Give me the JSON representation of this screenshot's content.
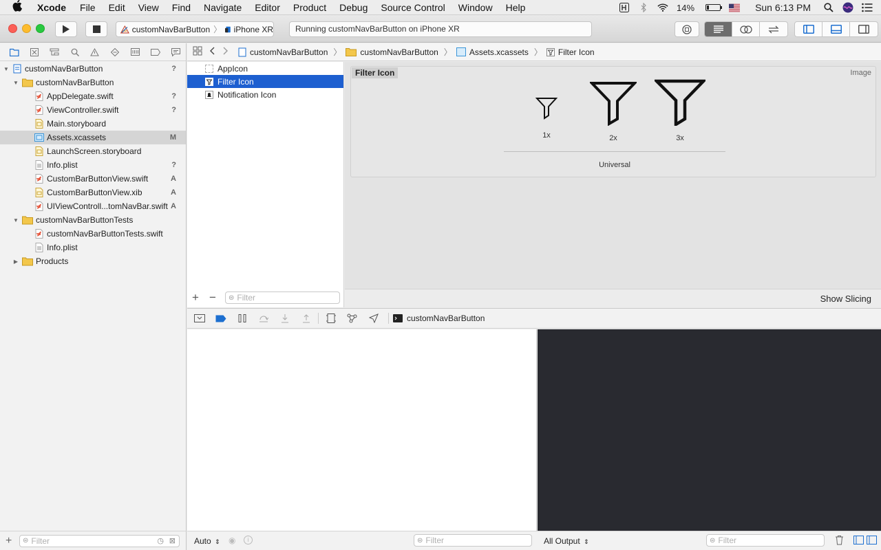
{
  "menubar": {
    "app_name": "Xcode",
    "items": [
      "File",
      "Edit",
      "View",
      "Find",
      "Navigate",
      "Editor",
      "Product",
      "Debug",
      "Source Control",
      "Window",
      "Help"
    ],
    "battery": "14%",
    "battery_level": 0.14,
    "clock": "Sun 6:13 PM"
  },
  "toolbar": {
    "scheme_name": "customNavBarButton",
    "device": "iPhone XR",
    "activity": "Running customNavBarButton on iPhone XR"
  },
  "navigator": {
    "tree": [
      {
        "label": "customNavBarButton",
        "status": "?"
      },
      {
        "label": "customNavBarButton",
        "status": ""
      },
      {
        "label": "AppDelegate.swift",
        "status": "?"
      },
      {
        "label": "ViewController.swift",
        "status": "?"
      },
      {
        "label": "Main.storyboard",
        "status": ""
      },
      {
        "label": "Assets.xcassets",
        "status": "M"
      },
      {
        "label": "LaunchScreen.storyboard",
        "status": ""
      },
      {
        "label": "Info.plist",
        "status": "?"
      },
      {
        "label": "CustomBarButtonView.swift",
        "status": "A"
      },
      {
        "label": "CustomBarButtonView.xib",
        "status": "A"
      },
      {
        "label": "UIViewControll...tomNavBar.swift",
        "status": "A"
      },
      {
        "label": "customNavBarButtonTests",
        "status": ""
      },
      {
        "label": "customNavBarButtonTests.swift",
        "status": ""
      },
      {
        "label": "Info.plist",
        "status": ""
      },
      {
        "label": "Products",
        "status": ""
      }
    ],
    "filter_placeholder": "Filter"
  },
  "jumpbar": {
    "crumbs": [
      "customNavBarButton",
      "customNavBarButton",
      "Assets.xcassets",
      "Filter Icon"
    ]
  },
  "assets": {
    "items": [
      "AppIcon",
      "Filter Icon",
      "Notification Icon"
    ],
    "filter_placeholder": "Filter"
  },
  "editor": {
    "title": "Filter Icon",
    "type_label": "Image",
    "slots": [
      "1x",
      "2x",
      "3x"
    ],
    "group_label": "Universal",
    "show_slicing": "Show Slicing"
  },
  "debug": {
    "target": "customNavBarButton",
    "auto_label": "Auto",
    "output_label": "All Output",
    "filter_placeholder": "Filter"
  }
}
